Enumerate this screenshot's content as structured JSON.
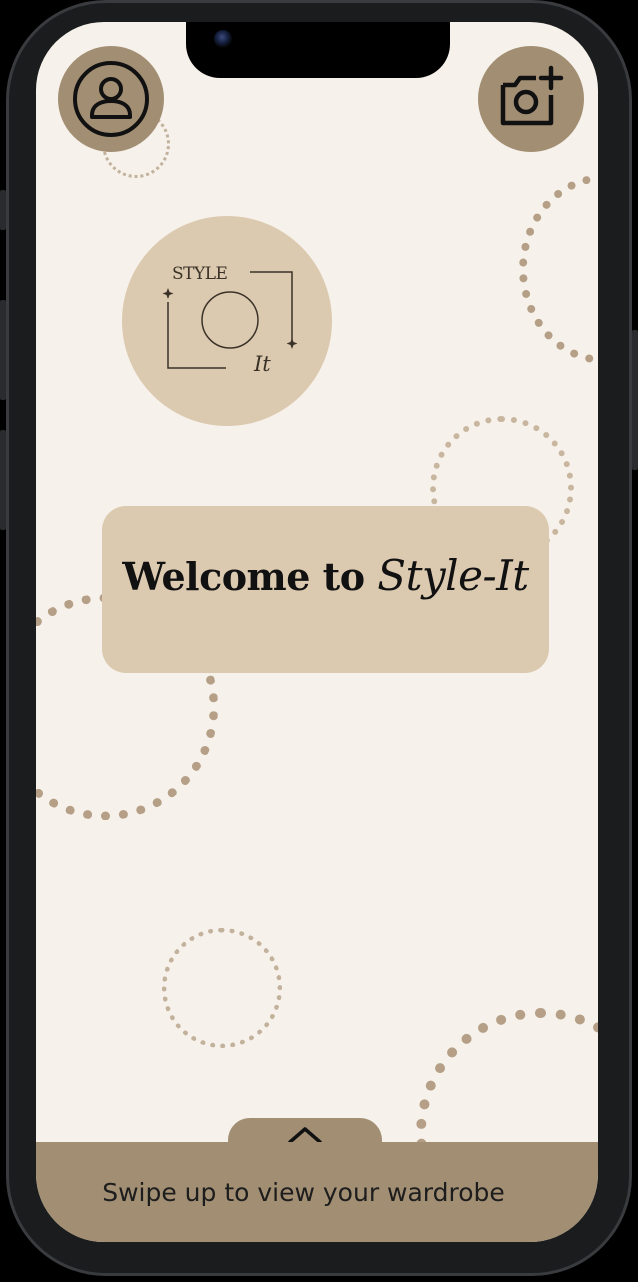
{
  "app": {
    "name": "Style-It"
  },
  "header": {
    "profile_icon": "user-icon",
    "camera_icon": "camera-add-icon"
  },
  "logo": {
    "top_text": "STYLE",
    "bottom_text": "It"
  },
  "welcome": {
    "prefix": "Welcome to",
    "brand": "Style-It"
  },
  "bottom_sheet": {
    "handle_icon": "chevron-up-icon",
    "hint": "Swipe up to view your wardrobe"
  },
  "colors": {
    "background": "#f6f1ea",
    "accent": "#a28f73",
    "card": "#dccab0",
    "ring": "#b59f86"
  }
}
